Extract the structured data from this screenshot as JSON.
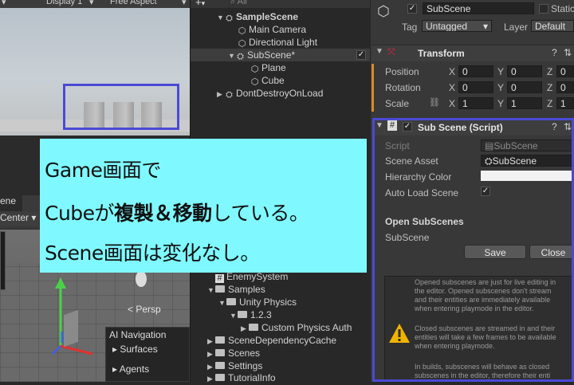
{
  "game_toolbar": {
    "display": "Display 1",
    "aspect": "Free Aspect"
  },
  "scene_view": {
    "tab": "ene",
    "pivot": "Center",
    "persp": "< Persp"
  },
  "ai_navigation": {
    "title": "AI Navigation",
    "items": [
      "Surfaces",
      "Agents"
    ]
  },
  "hierarchy": {
    "search_placeholder": "All",
    "add_button": "+",
    "rows": [
      {
        "label": "SampleScene",
        "indent": 0
      },
      {
        "label": "Main Camera",
        "indent": 1
      },
      {
        "label": "Directional Light",
        "indent": 1
      },
      {
        "label": "SubScene*",
        "indent": 1
      },
      {
        "label": "Plane",
        "indent": 2
      },
      {
        "label": "Cube",
        "indent": 2
      },
      {
        "label": "DontDestroyOnLoad",
        "indent": 0
      }
    ]
  },
  "project": {
    "enemy_system": "EnemySystem",
    "rows": [
      {
        "label": "Samples",
        "indent": 0
      },
      {
        "label": "Unity Physics",
        "indent": 1
      },
      {
        "label": "1.2.3",
        "indent": 2
      },
      {
        "label": "Custom Physics Auth",
        "indent": 3
      },
      {
        "label": "SceneDependencyCache",
        "indent": 0
      },
      {
        "label": "Scenes",
        "indent": 0
      },
      {
        "label": "Settings",
        "indent": 0
      },
      {
        "label": "TutorialInfo",
        "indent": 0
      }
    ]
  },
  "inspector": {
    "object_name": "SubScene",
    "static_label": "Static",
    "tag_label": "Tag",
    "tag_value": "Untagged",
    "layer_label": "Layer",
    "layer_value": "Default",
    "transform": {
      "title": "Transform",
      "position": {
        "label": "Position",
        "x": "0",
        "y": "0",
        "z": "0"
      },
      "rotation": {
        "label": "Rotation",
        "x": "0",
        "y": "0",
        "z": "0"
      },
      "scale": {
        "label": "Scale",
        "x": "1",
        "y": "1",
        "z": "1"
      },
      "axis_x": "X",
      "axis_y": "Y",
      "axis_z": "Z"
    },
    "subscene_script": {
      "title": "Sub Scene (Script)",
      "script_label": "Script",
      "script_value": "SubScene",
      "scene_asset_label": "Scene Asset",
      "scene_asset_value": "SubScene",
      "hierarchy_color_label": "Hierarchy Color",
      "auto_load_label": "Auto Load Scene",
      "open_subscenes_label": "Open SubScenes",
      "open_subscene_item": "SubScene",
      "save_button": "Save",
      "close_button": "Close"
    },
    "info_lines": [
      "Opened subscenes are just for live editing in",
      "the editor. Opened subscenes don't stream",
      "and their entities are immediately available",
      "when entering playmode in the editor.",
      "",
      "Closed subscenes are streamed in and their",
      "entities will take a few frames to be available",
      "when entering playmode.",
      "",
      "In builds, subscenes will behave as closed",
      "subscenes in the editor, therefore their enti"
    ]
  },
  "annotation": {
    "line1": "Game画面で",
    "line2_pre": "Cubeが",
    "line2_bold": "複製＆移動",
    "line2_post": "している。",
    "line3": "Scene画面は変化なし。"
  },
  "colors": {
    "highlight_border": "#4a4ad6",
    "annotation_bg": "#7ff9ff"
  }
}
